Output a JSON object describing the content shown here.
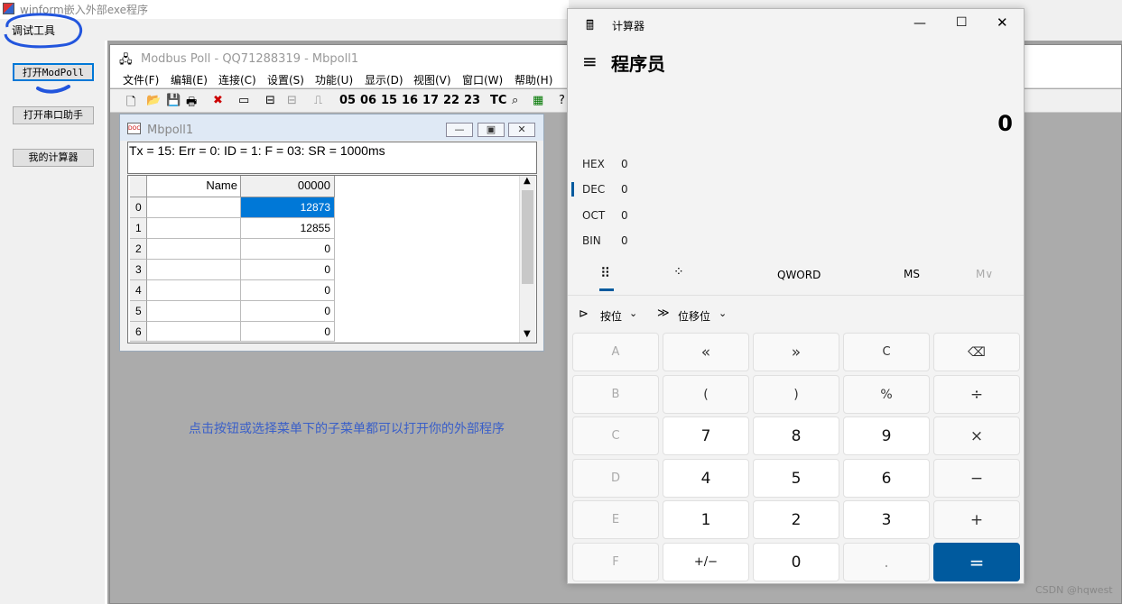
{
  "host": {
    "title": "winform嵌入外部exe程序",
    "menu": "调试工具",
    "buttons": [
      "打开ModPoll",
      "打开串口助手",
      "我的计算器"
    ],
    "hint": "点击按钮或选择菜单下的子菜单都可以打开你的外部程序"
  },
  "modbus": {
    "title": "Modbus Poll - QQ71288319 - Mbpoll1",
    "menu": [
      "文件(F)",
      "编辑(E)",
      "连接(C)",
      "设置(S)",
      "功能(U)",
      "显示(D)",
      "视图(V)",
      "窗口(W)",
      "帮助(H)"
    ],
    "toolbar_codes": [
      "05",
      "06",
      "15",
      "16",
      "17",
      "22",
      "23",
      "TC"
    ],
    "child": {
      "title": "Mbpoll1",
      "status": "Tx = 15: Err = 0: ID = 1: F = 03: SR = 1000ms",
      "col_name": "Name",
      "col_addr": "00000",
      "rows": [
        {
          "idx": "0",
          "value": "12873"
        },
        {
          "idx": "1",
          "value": "12855"
        },
        {
          "idx": "2",
          "value": "0"
        },
        {
          "idx": "3",
          "value": "0"
        },
        {
          "idx": "4",
          "value": "0"
        },
        {
          "idx": "5",
          "value": "0"
        },
        {
          "idx": "6",
          "value": "0"
        }
      ]
    }
  },
  "calc": {
    "title": "计算器",
    "mode": "程序员",
    "display": "0",
    "bases": [
      {
        "name": "HEX",
        "value": "0"
      },
      {
        "name": "DEC",
        "value": "0"
      },
      {
        "name": "OCT",
        "value": "0"
      },
      {
        "name": "BIN",
        "value": "0"
      }
    ],
    "word_size": "QWORD",
    "ms": "MS",
    "mv": "M∨",
    "bitwise": "按位",
    "bitshift": "位移位",
    "keys": [
      [
        "A",
        "«",
        "»",
        "C",
        "⌫"
      ],
      [
        "B",
        "(",
        ")",
        "%",
        "÷"
      ],
      [
        "C",
        "7",
        "8",
        "9",
        "×"
      ],
      [
        "D",
        "4",
        "5",
        "6",
        "−"
      ],
      [
        "E",
        "1",
        "2",
        "3",
        "+"
      ],
      [
        "F",
        "+/−",
        "0",
        ".",
        "="
      ]
    ]
  },
  "watermark": "CSDN @hqwest"
}
